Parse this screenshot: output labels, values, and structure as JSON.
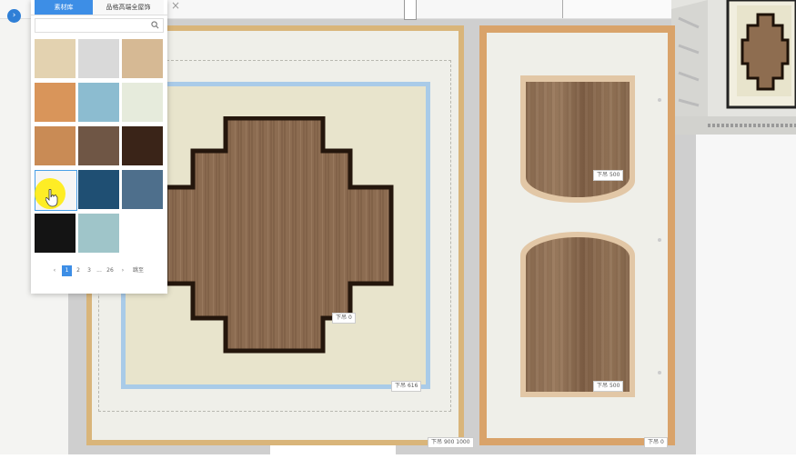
{
  "panel": {
    "tabs": [
      "素材库",
      "品格高端全屋饰"
    ],
    "search": {
      "placeholder": ""
    },
    "swatches": [
      {
        "name": "beige-fabric",
        "color": "#e3d2b0"
      },
      {
        "name": "white-quilted",
        "color": "#d9d9d9"
      },
      {
        "name": "light-wood",
        "color": "#d6b994"
      },
      {
        "name": "orange-wood",
        "color": "#d9955a"
      },
      {
        "name": "sky-blue",
        "color": "#8cbcd0"
      },
      {
        "name": "pale-mint",
        "color": "#e6ebdc"
      },
      {
        "name": "tan-wood",
        "color": "#c98b55"
      },
      {
        "name": "striped-brown",
        "color": "#6f5645"
      },
      {
        "name": "dark-walnut",
        "color": "#3a2418"
      },
      {
        "name": "white-selected",
        "color": "#f5f5f5"
      },
      {
        "name": "navy-blue",
        "color": "#1f4f73"
      },
      {
        "name": "steel-blue",
        "color": "#4e6f8c"
      },
      {
        "name": "black",
        "color": "#141414"
      },
      {
        "name": "aqua-gray",
        "color": "#9fc5c9"
      }
    ],
    "pager": {
      "prev": "‹",
      "pages": [
        "1",
        "2",
        "3",
        "...",
        "26"
      ],
      "next": "›",
      "jump": "跳至"
    }
  },
  "floor": {
    "accent_blue": "#3d8ee6",
    "tags": {
      "center": {
        "label": "下吊",
        "value": "0"
      },
      "inner": {
        "label": "下吊",
        "value": "616"
      },
      "room_left": {
        "label": "下吊",
        "value": "900 1000"
      },
      "door_top": {
        "label": "下吊",
        "value": "500"
      },
      "door_bottom": {
        "label": "下吊",
        "value": "500"
      },
      "room_right": {
        "label": "下吊",
        "value": "0"
      }
    }
  }
}
